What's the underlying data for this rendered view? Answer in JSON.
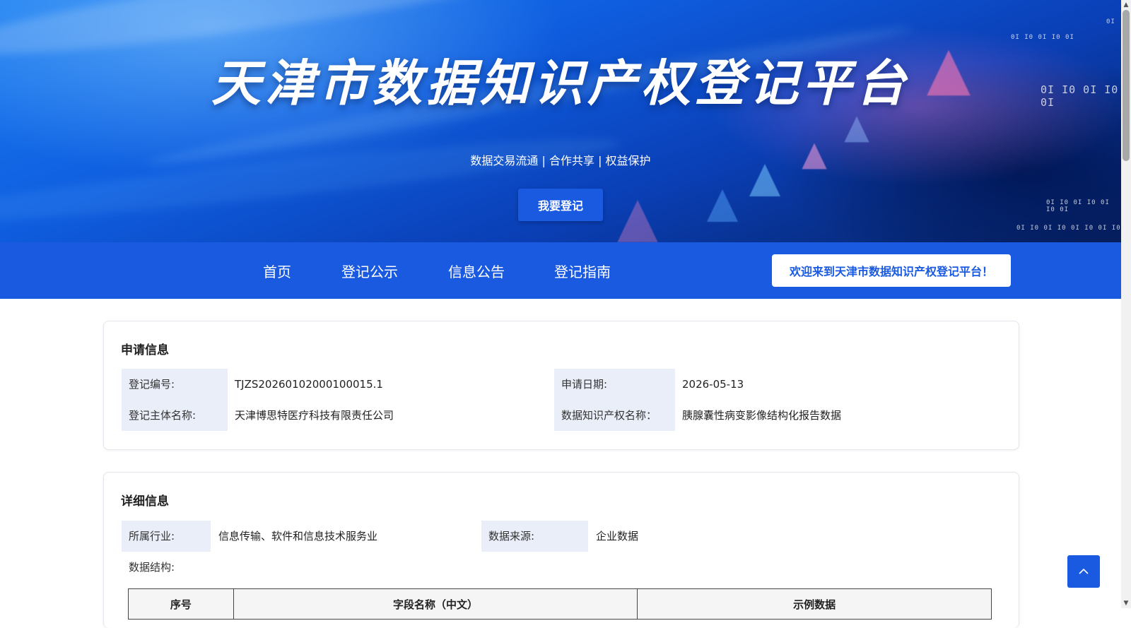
{
  "hero": {
    "title": "天津市数据知识产权登记平台",
    "subtitle": "数据交易流通 | 合作共享 | 权益保护",
    "register_button": "我要登记"
  },
  "nav": {
    "items": [
      {
        "label": "首页"
      },
      {
        "label": "登记公示"
      },
      {
        "label": "信息公告"
      },
      {
        "label": "登记指南"
      }
    ],
    "welcome": "欢迎来到天津市数据知识产权登记平台！"
  },
  "application": {
    "title": "申请信息",
    "reg_no_label": "登记编号:",
    "reg_no_value": "TJZS20260102000100015.1",
    "subject_label": "登记主体名称:",
    "subject_value": "天津博思特医疗科技有限责任公司",
    "date_label": "申请日期:",
    "date_value": "2026-05-13",
    "ip_name_label": "数据知识产权名称：",
    "ip_name_value": "胰腺囊性病变影像结构化报告数据"
  },
  "details": {
    "title": "详细信息",
    "industry_label": "所属行业:",
    "industry_value": "信息传输、软件和信息技术服务业",
    "source_label": "数据来源:",
    "source_value": "企业数据",
    "structure_label": "数据结构:",
    "table_headers": [
      "序号",
      "字段名称（中文）",
      "示例数据"
    ]
  },
  "colors": {
    "primary": "#1a5ae0",
    "label_bg": "#e9eef8"
  },
  "icons": {
    "back_to_top": "chevron-up-icon"
  }
}
